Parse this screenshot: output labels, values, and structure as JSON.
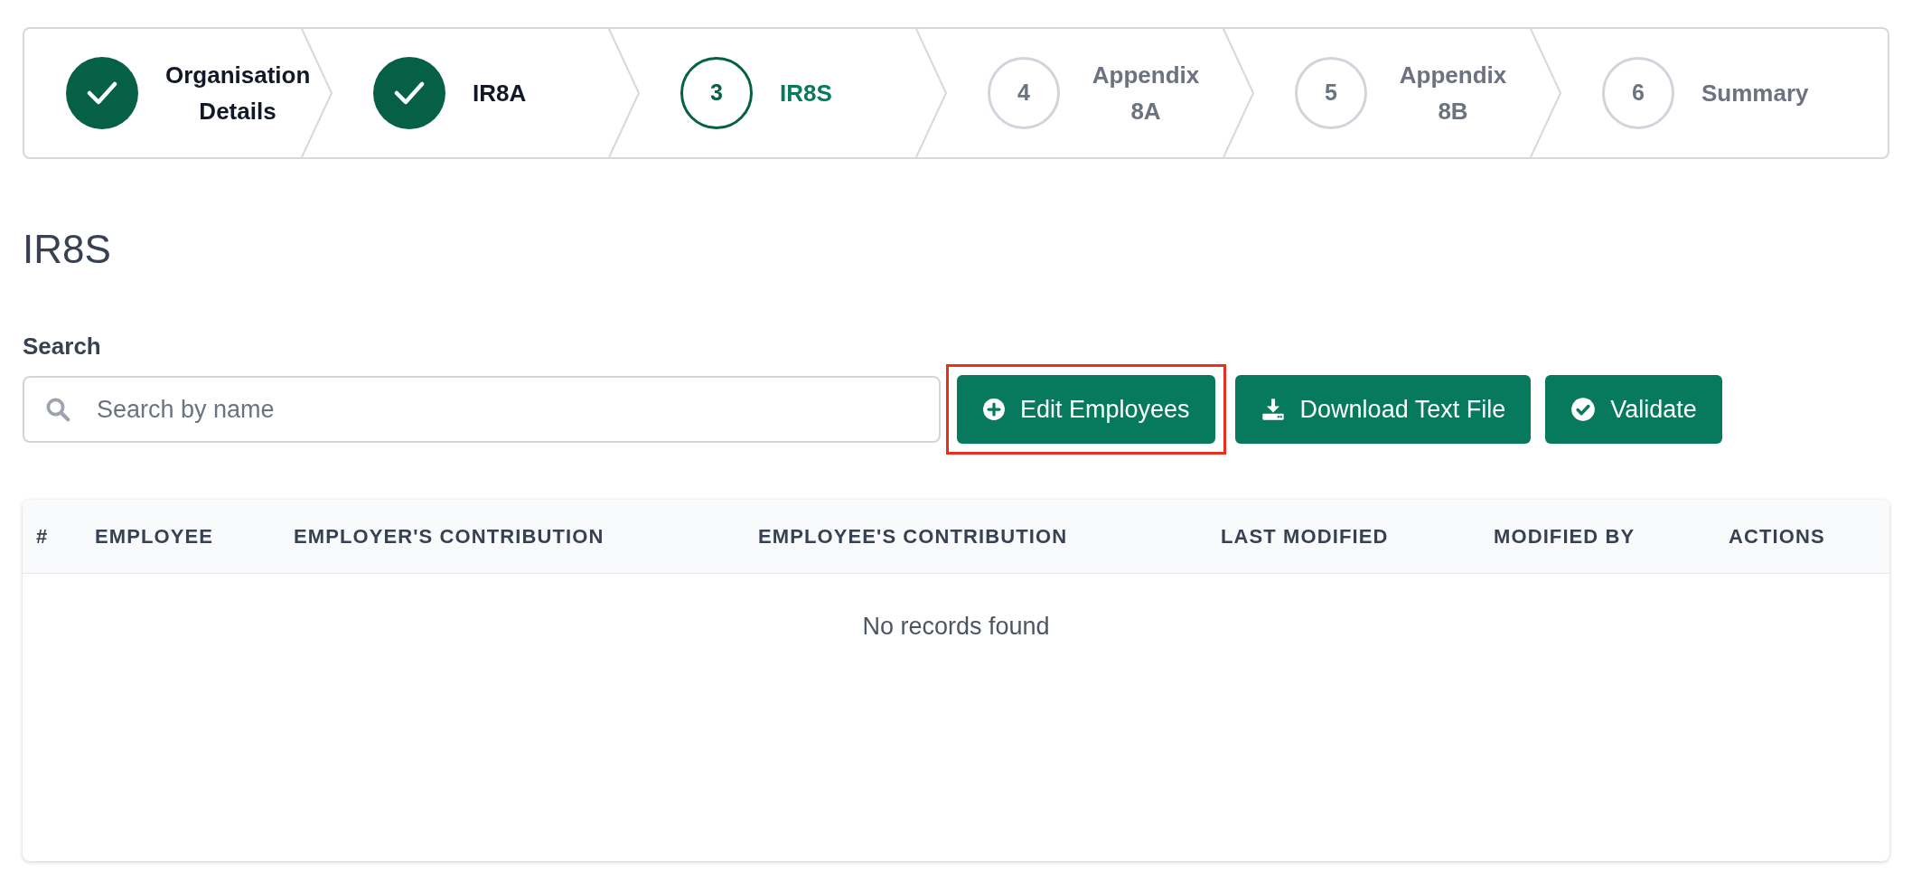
{
  "steps": [
    {
      "label": "Organisation Details",
      "completed": true,
      "selected": false
    },
    {
      "label": "IR8A",
      "completed": true,
      "selected": false
    },
    {
      "number": "3",
      "label": "IR8S",
      "completed": false,
      "selected": true
    },
    {
      "number": "4",
      "label": "Appendix 8A",
      "completed": false,
      "selected": false
    },
    {
      "number": "5",
      "label": "Appendix 8B",
      "completed": false,
      "selected": false
    },
    {
      "number": "6",
      "label": "Summary",
      "completed": false,
      "selected": false
    }
  ],
  "page_title": "IR8S",
  "search": {
    "label": "Search",
    "placeholder": "Search by name"
  },
  "buttons": [
    {
      "label": "Edit Employees",
      "highlighted": true
    },
    {
      "label": "Download Text File",
      "highlighted": false
    },
    {
      "label": "Validate",
      "highlighted": false
    }
  ],
  "table": {
    "columns": [
      "#",
      "EMPLOYEE",
      "EMPLOYER'S CONTRIBUTION",
      "EMPLOYEE'S CONTRIBUTION",
      "LAST MODIFIED",
      "MODIFIED BY",
      "ACTIONS"
    ],
    "empty_message": "No records found"
  }
}
